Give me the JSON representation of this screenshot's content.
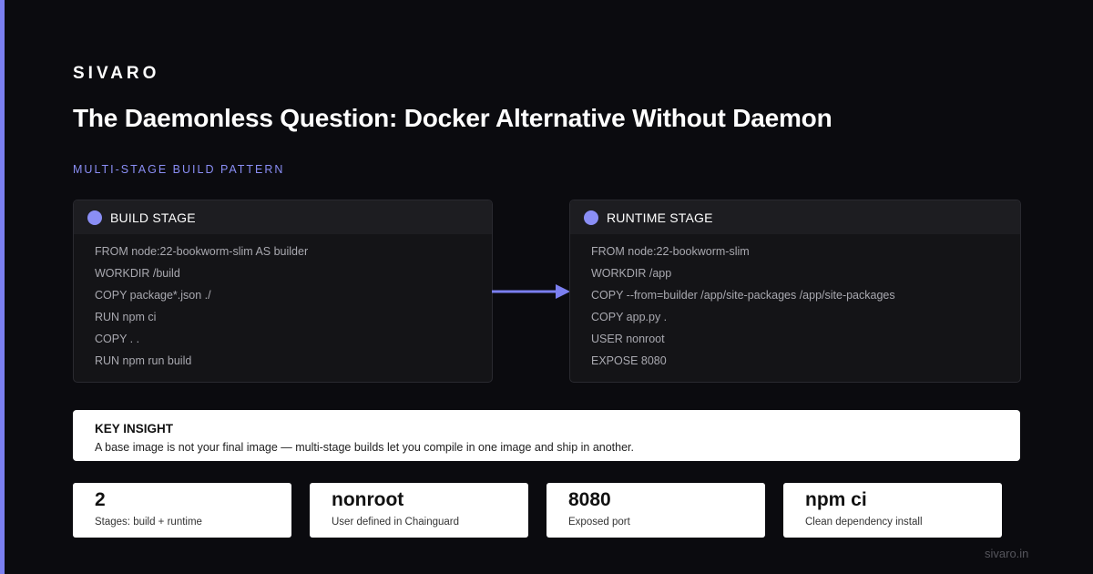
{
  "brand": "SIVARO",
  "title": "The Daemonless Question: Docker Alternative Without Daemon",
  "section_label": "MULTI-STAGE BUILD PATTERN",
  "colors": {
    "accent": "#8a8ef5",
    "background": "#0b0b0f"
  },
  "build_stage": {
    "title": "BUILD STAGE",
    "lines": [
      "FROM node:22-bookworm-slim AS builder",
      "WORKDIR /build",
      "COPY package*.json ./",
      "RUN npm ci",
      "COPY . .",
      "RUN npm run build"
    ]
  },
  "runtime_stage": {
    "title": "RUNTIME STAGE",
    "lines": [
      "FROM node:22-bookworm-slim",
      "WORKDIR /app",
      "COPY --from=builder /app/site-packages /app/site-packages",
      "COPY app.py .",
      "USER nonroot",
      "EXPOSE 8080"
    ]
  },
  "insight": {
    "title": "KEY INSIGHT",
    "text": "A base image is not your final image — multi-stage builds let you compile in one image and ship in another."
  },
  "stats": [
    {
      "value": "2",
      "label": "Stages: build + runtime"
    },
    {
      "value": "nonroot",
      "label": "User defined in Chainguard"
    },
    {
      "value": "8080",
      "label": "Exposed port"
    },
    {
      "value": "npm ci",
      "label": "Clean dependency install"
    }
  ],
  "footer_url": "sivaro.in"
}
